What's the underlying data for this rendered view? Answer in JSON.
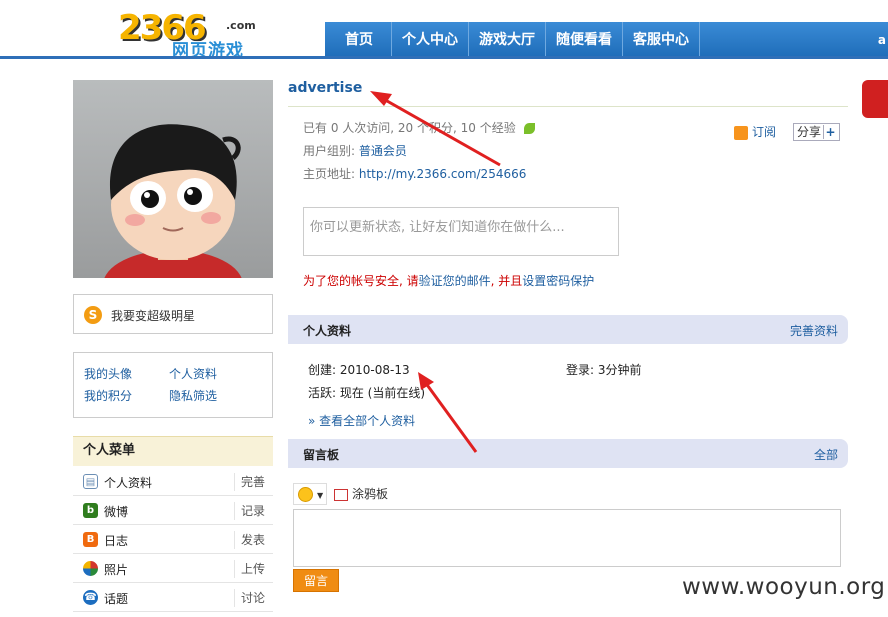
{
  "header": {
    "logo_number": "2366",
    "logo_domain": ".com",
    "logo_text": "网页游戏",
    "nav": [
      "首页",
      "个人中心",
      "游戏大厅",
      "随便看看",
      "客服中心"
    ],
    "nav_end": "a"
  },
  "sidebar": {
    "star_label": "我要变超级明星",
    "links": [
      "我的头像",
      "个人资料",
      "我的积分",
      "隐私筛选"
    ],
    "menu_title": "个人菜单",
    "menu": [
      {
        "label": "个人资料",
        "action": "完善",
        "icon": "profile-icon",
        "color": "#6c8fb5"
      },
      {
        "label": "微博",
        "action": "记录",
        "icon": "weibo-icon",
        "color": "#2f7d1e"
      },
      {
        "label": "日志",
        "action": "发表",
        "icon": "blog-icon",
        "color": "#f06a0f"
      },
      {
        "label": "照片",
        "action": "上传",
        "icon": "photo-icon",
        "color": "#d3362d"
      },
      {
        "label": "话题",
        "action": "讨论",
        "icon": "topic-icon",
        "color": "#1c6dbf"
      }
    ]
  },
  "profile": {
    "username": "advertise",
    "stats": "已有 0 人次访问, 20 个积分, 10 个经验",
    "group_label": "用户组别:",
    "group_value": "普通会员",
    "home_label": "主页地址:",
    "home_value": "http://my.2366.com/254666",
    "subscribe": "订阅",
    "share": "分享",
    "status_placeholder": "你可以更新状态, 让好友们知道你在做什么...",
    "security_prefix": "为了您的帐号安全, 请",
    "security_link1": "验证您的邮件",
    "security_mid": ", 并且",
    "security_link2": "设置密码保护"
  },
  "info_section": {
    "title": "个人资料",
    "action": "完善资料",
    "created": "创建: 2010-08-13",
    "login": "登录: 3分钟前",
    "active": "活跃: 现在 (当前在线)",
    "view_all": "» 查看全部个人资料"
  },
  "guestbook": {
    "title": "留言板",
    "action": "全部",
    "doodle": "涂鸦板",
    "post": "留言"
  },
  "watermark": "www.wooyun.org"
}
